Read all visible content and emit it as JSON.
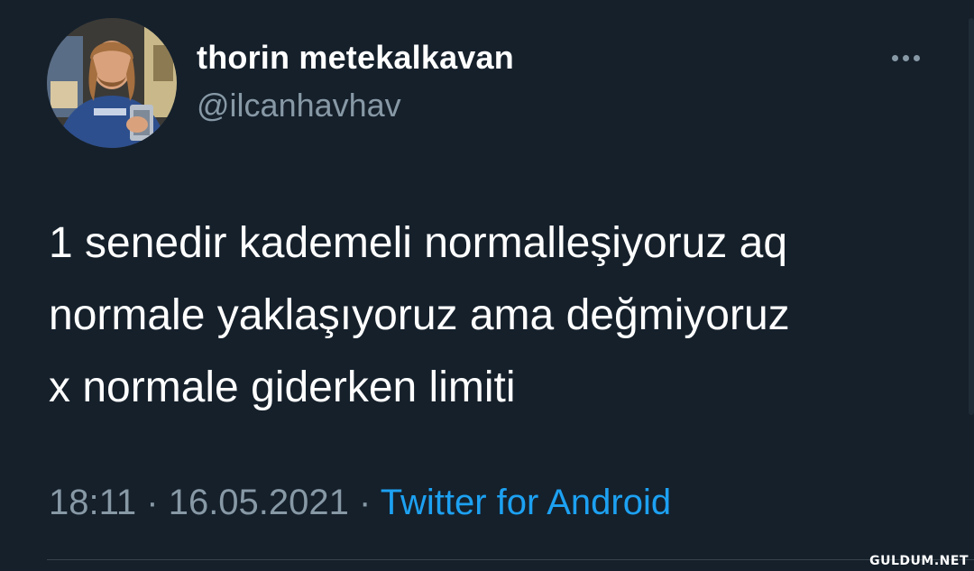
{
  "tweet": {
    "author": {
      "display_name": "thorin metekalkavan",
      "handle": "@ilcanhavhav"
    },
    "text_lines": [
      "1 senedir kademeli normalleşiyoruz aq",
      "normale yaklaşıyoruz ama değmiyoruz",
      "x normale giderken limiti"
    ],
    "time": "18:11",
    "separator": "·",
    "date": "16.05.2021",
    "source": "Twitter for Android",
    "more_icon": "ellipsis-horizontal-icon"
  },
  "watermark": "GULDUM.NET",
  "colors": {
    "background": "#15202b",
    "primary_text": "#ffffff",
    "secondary_text": "#8899a6",
    "link": "#1da1f2"
  }
}
